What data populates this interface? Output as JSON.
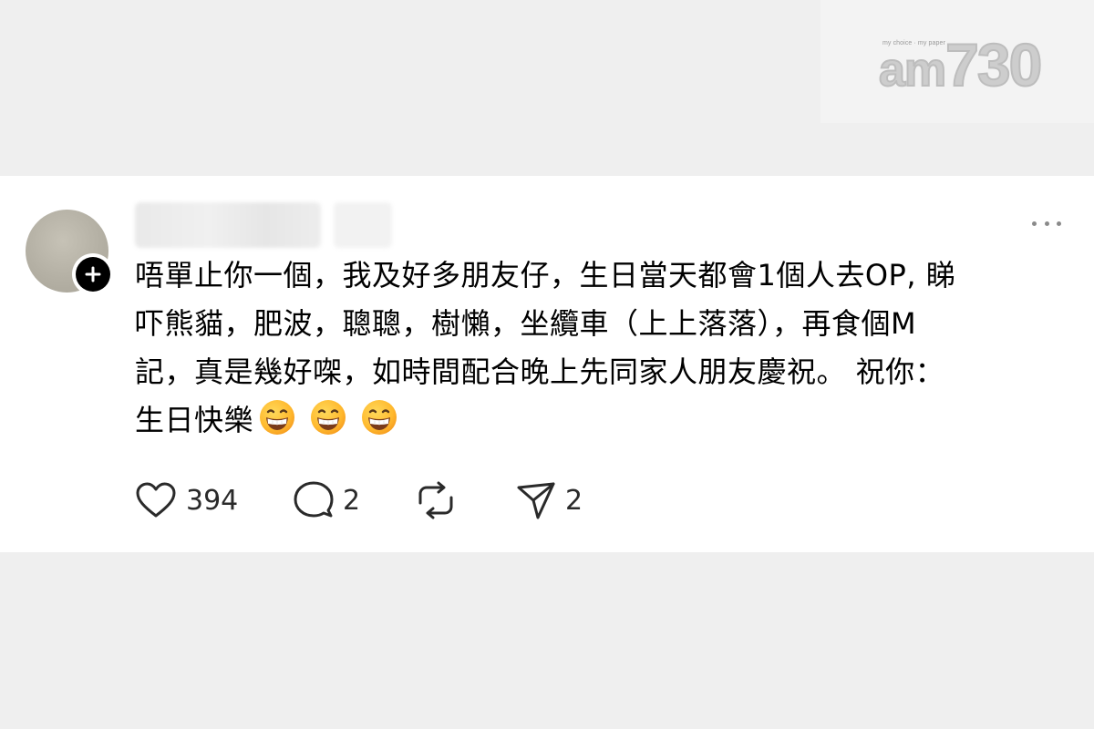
{
  "watermark": {
    "tagline": "my choice · my paper",
    "logo_am": "am",
    "logo_num": "730"
  },
  "post": {
    "lines": [
      "唔單止你一個，我及好多朋友仔，生日當天都會1個人去OP, 睇",
      "吓熊貓，肥波，聰聰，樹懶，坐纜車（上上落落），再食個M",
      "記，真是幾好㗎，如時間配合晚上先同家人朋友慶祝。 祝你：",
      "生日快樂"
    ],
    "emojis": [
      "grinning-face",
      "grinning-face",
      "grinning-face"
    ]
  },
  "actions": {
    "like_count": "394",
    "comment_count": "2",
    "repost_count": "",
    "share_count": "2"
  },
  "colors": {
    "background": "#efefef",
    "card": "#ffffff",
    "icon": "#2a2a2a",
    "emoji_face": "#ffc83d"
  },
  "icons": {
    "like": "heart-icon",
    "comment": "comment-bubble-icon",
    "repost": "repost-icon",
    "share": "send-icon",
    "more": "more-dots-icon",
    "follow": "plus-icon"
  }
}
